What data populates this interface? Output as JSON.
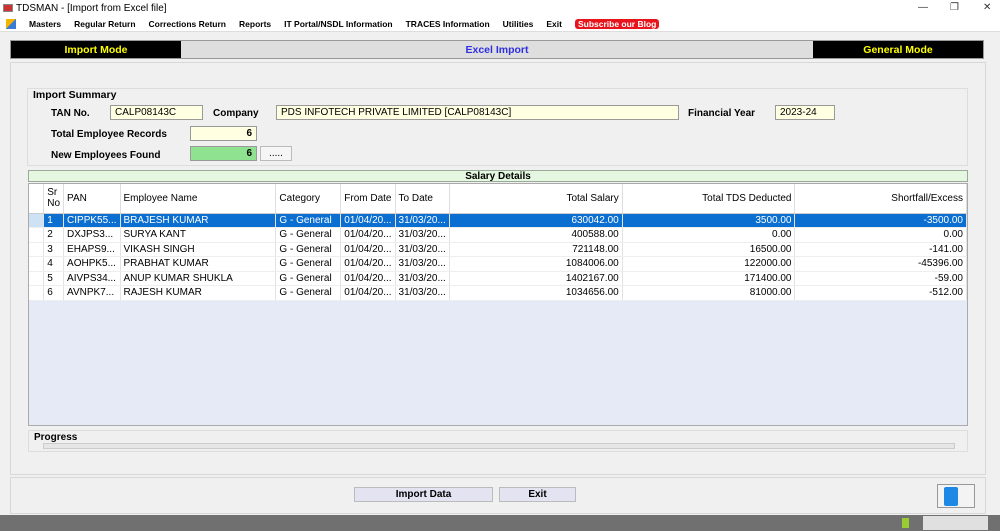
{
  "window": {
    "title": "TDSMAN - [Import from Excel file]"
  },
  "menu": [
    "Masters",
    "Regular Return",
    "Corrections Return",
    "Reports",
    "IT Portal/NSDL Information",
    "TRACES Information",
    "Utilities",
    "Exit"
  ],
  "blog": "Subscribe our Blog",
  "modebar": {
    "left": "Import Mode",
    "center": "Excel Import",
    "right": "General Mode"
  },
  "summary": {
    "title": "Import Summary",
    "tan_label": "TAN No.",
    "tan": "CALP08143C",
    "company_label": "Company",
    "company": "PDS INFOTECH PRIVATE LIMITED [CALP08143C]",
    "fy_label": "Financial Year",
    "fy": "2023-24",
    "total_label": "Total Employee Records",
    "total": "6",
    "new_label": "New Employees Found",
    "new": "6",
    "more": "....."
  },
  "salary": {
    "title": "Salary Details",
    "columns": [
      "Sr No",
      "PAN",
      "Employee Name",
      "Category",
      "From Date",
      "To Date",
      "Total Salary",
      "Total TDS Deducted",
      "Shortfall/Excess"
    ],
    "rows": [
      [
        "1",
        "CIPPK55...",
        "BRAJESH KUMAR",
        "G - General",
        "01/04/20...",
        "31/03/20...",
        "630042.00",
        "3500.00",
        "-3500.00"
      ],
      [
        "2",
        "DXJPS3...",
        "SURYA KANT",
        "G - General",
        "01/04/20...",
        "31/03/20...",
        "400588.00",
        "0.00",
        "0.00"
      ],
      [
        "3",
        "EHAPS9...",
        "VIKASH SINGH",
        "G - General",
        "01/04/20...",
        "31/03/20...",
        "721148.00",
        "16500.00",
        "-141.00"
      ],
      [
        "4",
        "AOHPK5...",
        "PRABHAT KUMAR",
        "G - General",
        "01/04/20...",
        "31/03/20...",
        "1084006.00",
        "122000.00",
        "-45396.00"
      ],
      [
        "5",
        "AIVPS34...",
        "ANUP KUMAR SHUKLA",
        "G - General",
        "01/04/20...",
        "31/03/20...",
        "1402167.00",
        "171400.00",
        "-59.00"
      ],
      [
        "6",
        "AVNPK7...",
        "RAJESH KUMAR",
        "G - General",
        "01/04/20...",
        "31/03/20...",
        "1034656.00",
        "81000.00",
        "-512.00"
      ]
    ]
  },
  "progress": {
    "label": "Progress",
    "value": 0
  },
  "buttons": {
    "import": "Import Data",
    "exit": "Exit"
  }
}
